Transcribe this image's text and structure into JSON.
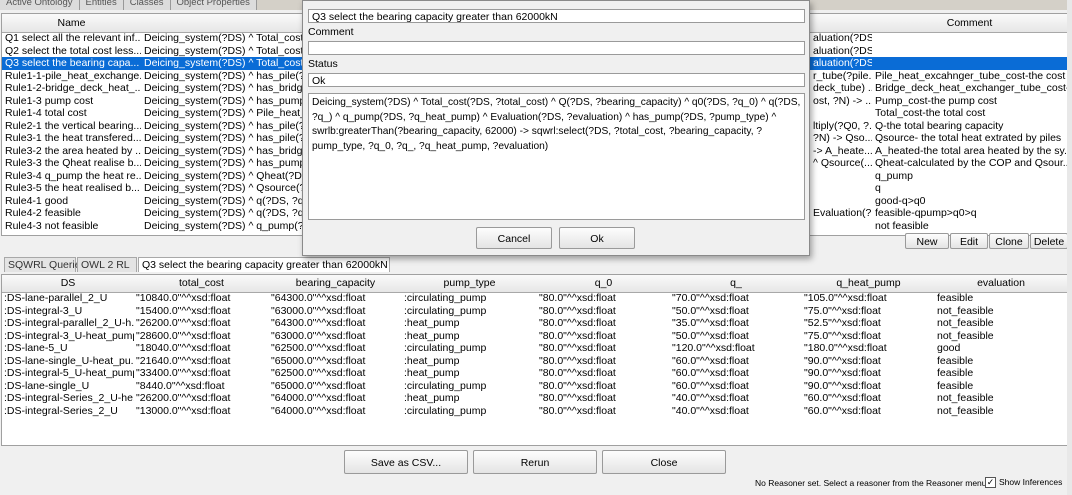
{
  "top_tabs": [
    "Active Ontology",
    "Entities",
    "Classes",
    "Object Properties"
  ],
  "rules_table": {
    "columns": [
      "Name",
      "",
      "Comment"
    ],
    "rows": [
      {
        "name": "Q1 select all the relevant inf...",
        "body": "Deicing_system(?DS) ^ Total_cost(?DS,",
        "mid": "aluation(?DS,...",
        "comment": ""
      },
      {
        "name": "Q2 select the total cost less...",
        "body": "Deicing_system(?DS) ^ Total_cost(?DS,",
        "mid": "aluation(?DS,...",
        "comment": ""
      },
      {
        "name": "Q3 select the bearing capa...",
        "body": "Deicing_system(?DS) ^ Total_cost(?DS,",
        "mid": "aluation(?DS,...",
        "comment": "",
        "selected": true
      },
      {
        "name": "Rule1-1-pile_heat_exchange...",
        "body": "Deicing_system(?DS) ^ has_pile(?DS,",
        "mid": "r_tube(?pile...",
        "comment": "Pile_heat_excahnger_tube_cost-the cost ..."
      },
      {
        "name": "Rule1-2-bridge_deck_heat_...",
        "body": "Deicing_system(?DS) ^ has_bridge_",
        "mid": "deck_tube) ...",
        "comment": "Bridge_deck_heat_exchanger_tube_cost-t..."
      },
      {
        "name": "Rule1-3 pump cost",
        "body": "Deicing_system(?DS) ^ has_pump(?DS,",
        "mid": "ost, ?N) -> ...",
        "comment": "Pump_cost-the pump cost"
      },
      {
        "name": "Rule1-4 total cost",
        "body": "Deicing_system(?DS) ^ Pile_heat_exc",
        "mid": "",
        "comment": "Total_cost-the total cost"
      },
      {
        "name": "Rule2-1 the vertical bearing...",
        "body": "Deicing_system(?DS) ^ has_pile(?DS,",
        "mid": "ltiply(?Q0, ?...",
        "comment": "Q-the total bearing capacity"
      },
      {
        "name": "Rule3-1 the heat transfered...",
        "body": "Deicing_system(?DS) ^ has_pile(?DS,",
        "mid": "?N) -> Qso...",
        "comment": "Qsource- the total heat extrated by piles"
      },
      {
        "name": "Rule3-2 the area heated by ...",
        "body": "Deicing_system(?DS) ^ has_bridge_",
        "mid": "-> A_heate...",
        "comment": "A_heated-the total area heated by the sy..."
      },
      {
        "name": "Rule3-3 the Qheat realise b...",
        "body": "Deicing_system(?DS) ^ has_pump(?DS,",
        "mid": "^ Qsource(...",
        "comment": "Qheat-calculated by the COP and Qsour..."
      },
      {
        "name": "Rule3-4 q_pump the heat re...",
        "body": "Deicing_system(?DS) ^ Qheat(?DS, ?",
        "mid": "",
        "comment": "q_pump"
      },
      {
        "name": "Rule3-5 the heat realised b...",
        "body": "Deicing_system(?DS) ^ Qsource(?DS",
        "mid": "",
        "comment": "q"
      },
      {
        "name": "Rule4-1 good",
        "body": "Deicing_system(?DS) ^ q(?DS, ?q_c)",
        "mid": "",
        "comment": "good-q>q0"
      },
      {
        "name": "Rule4-2 feasible",
        "body": "Deicing_system(?DS) ^ q(?DS, ?q_c)",
        "mid": "Evaluation(?...",
        "comment": "feasible-qpump>q0>q"
      },
      {
        "name": "Rule4-3 not feasible",
        "body": "Deicing_system(?DS) ^ q_pump(?DS",
        "mid": "",
        "comment": "not feasible"
      }
    ],
    "buttons": {
      "new": "New",
      "edit": "Edit",
      "clone": "Clone",
      "delete": "Delete"
    }
  },
  "lower_tabs": [
    "SQWRL Queries",
    "OWL 2 RL",
    "Q3 select the bearing capacity greater than 62000kN"
  ],
  "results": {
    "columns": [
      "DS",
      "total_cost",
      "bearing_capacity",
      "pump_type",
      "q_0",
      "q_",
      "q_heat_pump",
      "evaluation"
    ],
    "rows": [
      [
        ":DS-lane-parallel_2_U",
        "\"10840.0\"^^xsd:float",
        "\"64300.0\"^^xsd:float",
        ":circulating_pump",
        "\"80.0\"^^xsd:float",
        "\"70.0\"^^xsd:float",
        "\"105.0\"^^xsd:float",
        "feasible"
      ],
      [
        ":DS-integral-3_U",
        "\"15400.0\"^^xsd:float",
        "\"63000.0\"^^xsd:float",
        ":circulating_pump",
        "\"80.0\"^^xsd:float",
        "\"50.0\"^^xsd:float",
        "\"75.0\"^^xsd:float",
        "not_feasible"
      ],
      [
        ":DS-integral-parallel_2_U-h...",
        "\"26200.0\"^^xsd:float",
        "\"64300.0\"^^xsd:float",
        ":heat_pump",
        "\"80.0\"^^xsd:float",
        "\"35.0\"^^xsd:float",
        "\"52.5\"^^xsd:float",
        "not_feasible"
      ],
      [
        ":DS-integral-3_U-heat_pump",
        "\"28600.0\"^^xsd:float",
        "\"63000.0\"^^xsd:float",
        ":heat_pump",
        "\"80.0\"^^xsd:float",
        "\"50.0\"^^xsd:float",
        "\"75.0\"^^xsd:float",
        "not_feasible"
      ],
      [
        ":DS-lane-5_U",
        "\"18040.0\"^^xsd:float",
        "\"62500.0\"^^xsd:float",
        ":circulating_pump",
        "\"80.0\"^^xsd:float",
        "\"120.0\"^^xsd:float",
        "\"180.0\"^^xsd:float",
        "good"
      ],
      [
        ":DS-lane-single_U-heat_pu...",
        "\"21640.0\"^^xsd:float",
        "\"65000.0\"^^xsd:float",
        ":heat_pump",
        "\"80.0\"^^xsd:float",
        "\"60.0\"^^xsd:float",
        "\"90.0\"^^xsd:float",
        "feasible"
      ],
      [
        ":DS-integral-5_U-heat_pump",
        "\"33400.0\"^^xsd:float",
        "\"62500.0\"^^xsd:float",
        ":heat_pump",
        "\"80.0\"^^xsd:float",
        "\"60.0\"^^xsd:float",
        "\"90.0\"^^xsd:float",
        "feasible"
      ],
      [
        ":DS-lane-single_U",
        "\"8440.0\"^^xsd:float",
        "\"65000.0\"^^xsd:float",
        ":circulating_pump",
        "\"80.0\"^^xsd:float",
        "\"60.0\"^^xsd:float",
        "\"90.0\"^^xsd:float",
        "feasible"
      ],
      [
        ":DS-integral-Series_2_U-he...",
        "\"26200.0\"^^xsd:float",
        "\"64000.0\"^^xsd:float",
        ":heat_pump",
        "\"80.0\"^^xsd:float",
        "\"40.0\"^^xsd:float",
        "\"60.0\"^^xsd:float",
        "not_feasible"
      ],
      [
        ":DS-integral-Series_2_U",
        "\"13000.0\"^^xsd:float",
        "\"64000.0\"^^xsd:float",
        ":circulating_pump",
        "\"80.0\"^^xsd:float",
        "\"40.0\"^^xsd:float",
        "\"60.0\"^^xsd:float",
        "not_feasible"
      ]
    ]
  },
  "bottom_buttons": {
    "save_csv": "Save as CSV...",
    "rerun": "Rerun",
    "close": "Close"
  },
  "status_text": "No Reasoner set. Select a reasoner from the Reasoner menu",
  "show_inferences": {
    "label": "Show Inferences",
    "checked": true
  },
  "dialog": {
    "name_value": "Q3 select the bearing capacity greater than 62000kN",
    "comment_label": "Comment",
    "comment_value": "",
    "status_label": "Status",
    "status_value": "Ok",
    "rule_text": "Deicing_system(?DS) ^ Total_cost(?DS, ?total_cost) ^ Q(?DS, ?bearing_capacity) ^ q0(?DS, ?q_0) ^ q(?DS, ?q_) ^ q_pump(?DS, ?q_heat_pump) ^ Evaluation(?DS, ?evaluation) ^ has_pump(?DS, ?pump_type) ^ swrlb:greaterThan(?bearing_capacity, 62000) -> sqwrl:select(?DS, ?total_cost, ?bearing_capacity, ?pump_type, ?q_0, ?q_, ?q_heat_pump, ?evaluation)",
    "cancel_label": "Cancel",
    "ok_label": "Ok"
  }
}
